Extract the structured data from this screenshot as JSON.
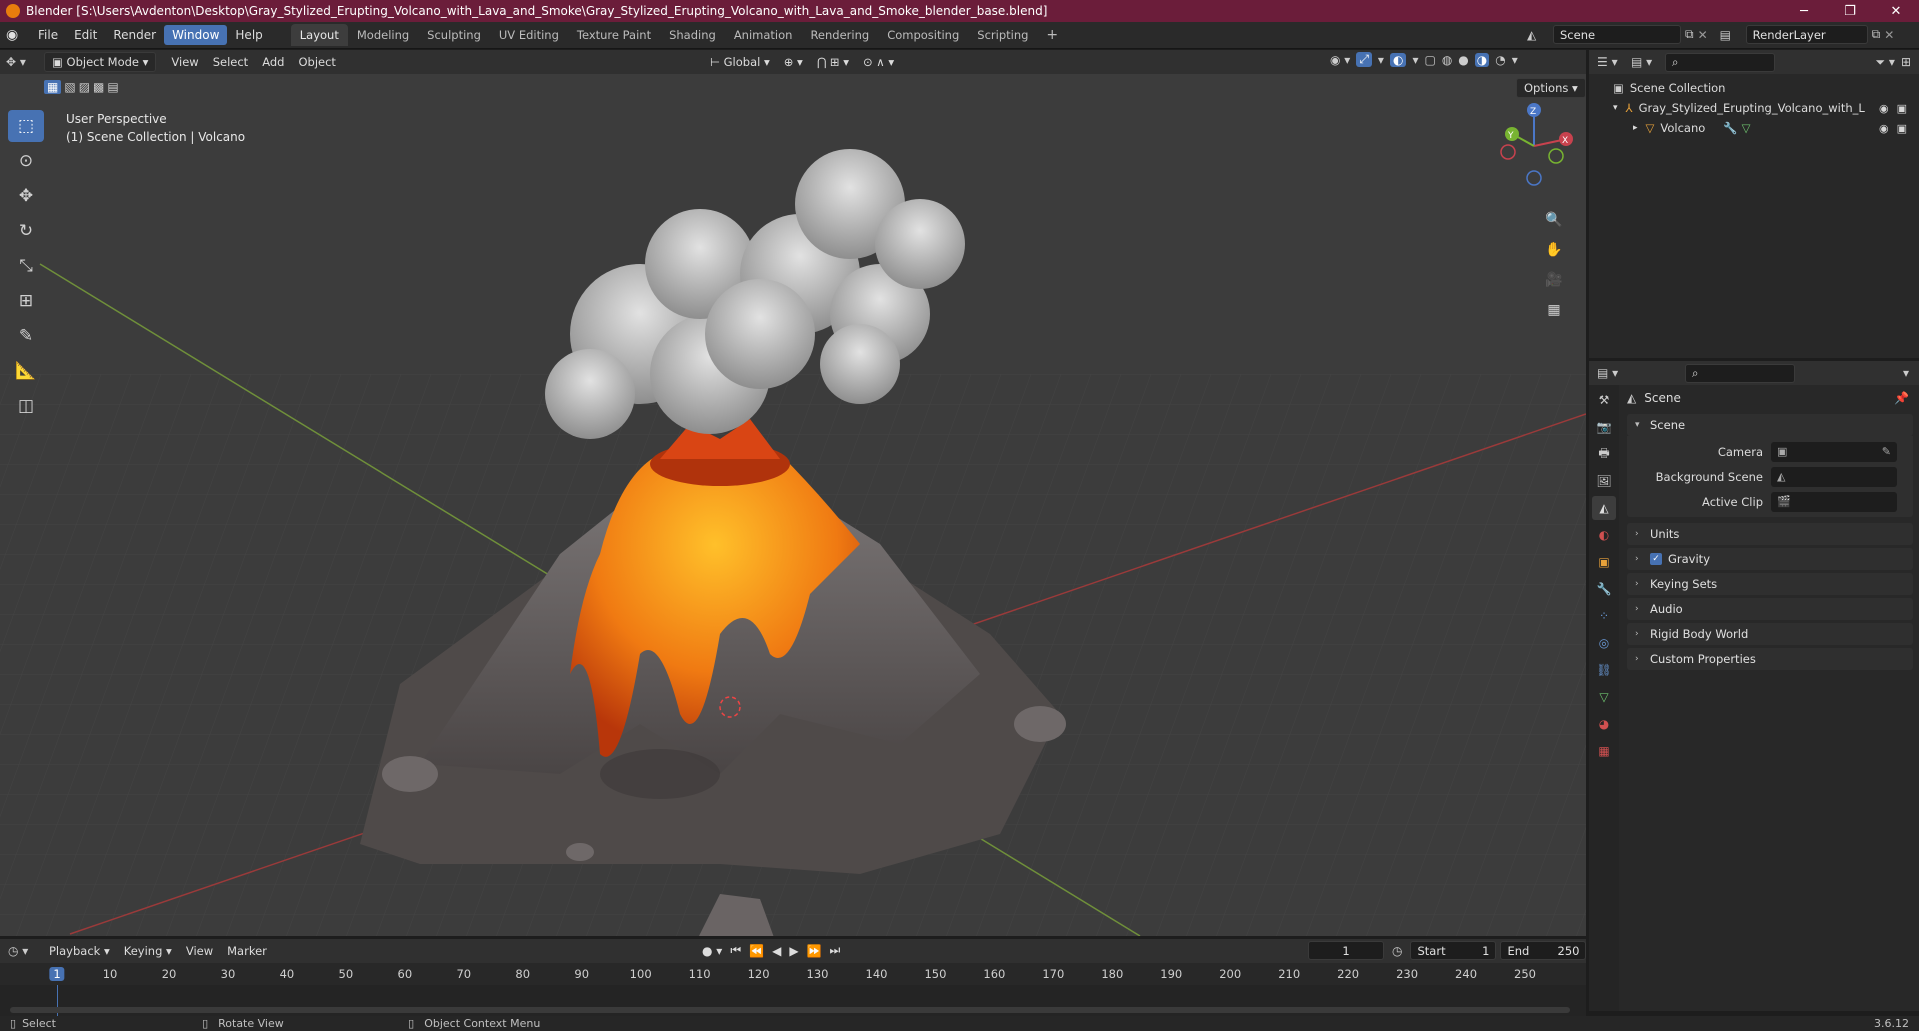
{
  "title": "Blender [S:\\Users\\Avdenton\\Desktop\\Gray_Stylized_Erupting_Volcano_with_Lava_and_Smoke\\Gray_Stylized_Erupting_Volcano_with_Lava_and_Smoke_blender_base.blend]",
  "menu": [
    "File",
    "Edit",
    "Render",
    "Window",
    "Help"
  ],
  "active_menu": "Window",
  "workspaces": [
    "Layout",
    "Modeling",
    "Sculpting",
    "UV Editing",
    "Texture Paint",
    "Shading",
    "Animation",
    "Rendering",
    "Compositing",
    "Scripting"
  ],
  "active_workspace": "Layout",
  "add_workspace": "+",
  "scene_name": "Scene",
  "render_layer": "RenderLayer",
  "viewport": {
    "mode": "Object Mode",
    "menus": [
      "View",
      "Select",
      "Add",
      "Object"
    ],
    "transform_orientation": "Global",
    "options_label": "Options",
    "info_line1": "User Perspective",
    "info_line2": "(1) Scene Collection | Volcano",
    "gizmo_axes": {
      "x": "X",
      "y": "Y",
      "z": "Z"
    }
  },
  "outliner": {
    "root": "Scene Collection",
    "collection": "Gray_Stylized_Erupting_Volcano_with_L",
    "object": "Volcano"
  },
  "properties": {
    "context_title": "Scene",
    "scene_panel": "Scene",
    "rows": [
      {
        "label": "Camera"
      },
      {
        "label": "Background Scene"
      },
      {
        "label": "Active Clip"
      }
    ],
    "panels": [
      "Units",
      "Gravity",
      "Keying Sets",
      "Audio",
      "Rigid Body World",
      "Custom Properties"
    ]
  },
  "timeline": {
    "menus": [
      "Playback",
      "Keying",
      "View",
      "Marker"
    ],
    "current_frame": "1",
    "start_label": "Start",
    "start": "1",
    "end_label": "End",
    "end": "250",
    "ticks": [
      "1",
      "10",
      "20",
      "30",
      "40",
      "50",
      "60",
      "70",
      "80",
      "90",
      "100",
      "110",
      "120",
      "130",
      "140",
      "150",
      "160",
      "170",
      "180",
      "190",
      "200",
      "210",
      "220",
      "230",
      "240",
      "250"
    ]
  },
  "status": {
    "select": "Select",
    "rotate": "Rotate View",
    "context_menu": "Object Context Menu",
    "version": "3.6.12"
  },
  "colors": {
    "accent": "#4772b3",
    "title_bar": "#6b1d3a",
    "lava": "#f07a12",
    "smoke": "#c9c9c9",
    "rock": "#5b5654"
  }
}
